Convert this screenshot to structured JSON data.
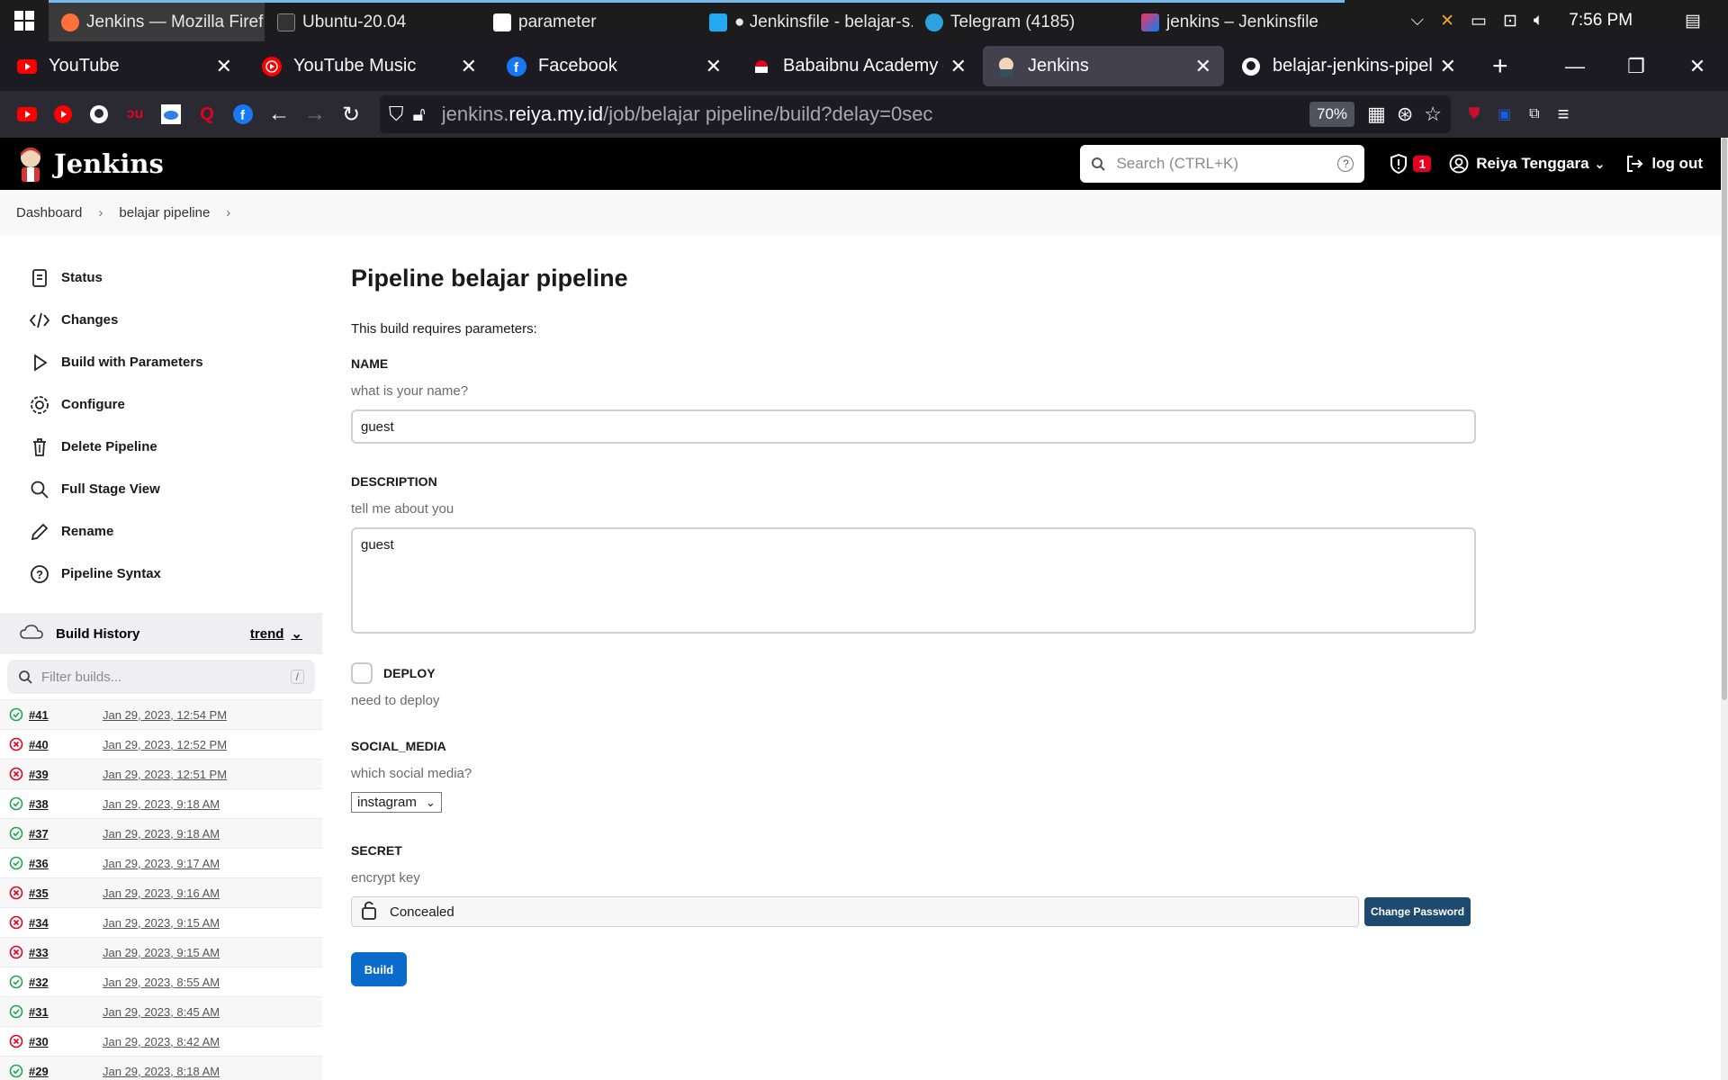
{
  "taskbar": {
    "items": [
      {
        "label": "Jenkins — Mozilla Firef...",
        "icon": "firefox-icon"
      },
      {
        "label": "Ubuntu-20.04",
        "icon": "terminal-icon"
      },
      {
        "label": "parameter",
        "icon": "notion-icon"
      },
      {
        "label": "● Jenkinsfile - belajar-s...",
        "icon": "vscode-icon"
      },
      {
        "label": "Telegram (4185)",
        "icon": "telegram-icon"
      },
      {
        "label": "jenkins – Jenkinsfile",
        "icon": "intellij-icon"
      }
    ],
    "clock": "7:56 PM"
  },
  "browser": {
    "tabs": [
      {
        "label": "YouTube",
        "icon": "youtube-icon"
      },
      {
        "label": "YouTube Music",
        "icon": "youtube-music-icon"
      },
      {
        "label": "Facebook",
        "icon": "facebook-icon"
      },
      {
        "label": "Babaibnu Academy –",
        "icon": "babaibnu-icon"
      },
      {
        "label": "Jenkins",
        "icon": "jenkins-icon"
      },
      {
        "label": "belajar-jenkins-pipeli",
        "icon": "github-icon"
      }
    ],
    "url_prefix": "jenkins.",
    "url_host": "reiya.my.id",
    "url_path": "/job/belajar pipeline/build?delay=0sec",
    "zoom": "70%"
  },
  "jenkins": {
    "brand": "Jenkins",
    "search_placeholder": "Search (CTRL+K)",
    "security_count": "1",
    "user": "Reiya Tenggara",
    "logout": "log out"
  },
  "breadcrumb": [
    "Dashboard",
    "belajar pipeline"
  ],
  "sidebar": {
    "items": [
      {
        "label": "Status",
        "icon": "status-icon"
      },
      {
        "label": "Changes",
        "icon": "code-icon"
      },
      {
        "label": "Build with Parameters",
        "icon": "play-icon"
      },
      {
        "label": "Configure",
        "icon": "gear-icon"
      },
      {
        "label": "Delete Pipeline",
        "icon": "trash-icon"
      },
      {
        "label": "Full Stage View",
        "icon": "search-icon"
      },
      {
        "label": "Rename",
        "icon": "pencil-icon"
      },
      {
        "label": "Pipeline Syntax",
        "icon": "help-icon"
      }
    ],
    "build_history": {
      "title": "Build History",
      "trend": "trend",
      "filter_placeholder": "Filter builds...",
      "filter_shortcut": "/",
      "builds": [
        {
          "num": "#41",
          "date": "Jan 29, 2023, 12:54 PM",
          "status": "success"
        },
        {
          "num": "#40",
          "date": "Jan 29, 2023, 12:52 PM",
          "status": "failed"
        },
        {
          "num": "#39",
          "date": "Jan 29, 2023, 12:51 PM",
          "status": "failed"
        },
        {
          "num": "#38",
          "date": "Jan 29, 2023, 9:18 AM",
          "status": "success"
        },
        {
          "num": "#37",
          "date": "Jan 29, 2023, 9:18 AM",
          "status": "success"
        },
        {
          "num": "#36",
          "date": "Jan 29, 2023, 9:17 AM",
          "status": "success"
        },
        {
          "num": "#35",
          "date": "Jan 29, 2023, 9:16 AM",
          "status": "failed"
        },
        {
          "num": "#34",
          "date": "Jan 29, 2023, 9:15 AM",
          "status": "failed"
        },
        {
          "num": "#33",
          "date": "Jan 29, 2023, 9:15 AM",
          "status": "failed"
        },
        {
          "num": "#32",
          "date": "Jan 29, 2023, 8:55 AM",
          "status": "success"
        },
        {
          "num": "#31",
          "date": "Jan 29, 2023, 8:45 AM",
          "status": "success"
        },
        {
          "num": "#30",
          "date": "Jan 29, 2023, 8:42 AM",
          "status": "failed"
        },
        {
          "num": "#29",
          "date": "Jan 29, 2023, 8:18 AM",
          "status": "success"
        }
      ]
    }
  },
  "main": {
    "title": "Pipeline belajar pipeline",
    "requires": "This build requires parameters:",
    "name": {
      "label": "NAME",
      "desc": "what is your name?",
      "value": "guest"
    },
    "description": {
      "label": "DESCRIPTION",
      "desc": "tell me about you",
      "value": "guest"
    },
    "deploy": {
      "label": "DEPLOY",
      "desc": "need to deploy",
      "checked": false
    },
    "social_media": {
      "label": "SOCIAL_MEDIA",
      "desc": "which social media?",
      "selected": "instagram"
    },
    "secret": {
      "label": "SECRET",
      "desc": "encrypt key",
      "value": "Concealed",
      "change_button": "Change Password"
    },
    "build_button": "Build"
  },
  "colors": {
    "success": "#1ea64b",
    "failed": "#e6001f",
    "build_button": "#0b6bcb",
    "change_password": "#1f4a6f"
  }
}
